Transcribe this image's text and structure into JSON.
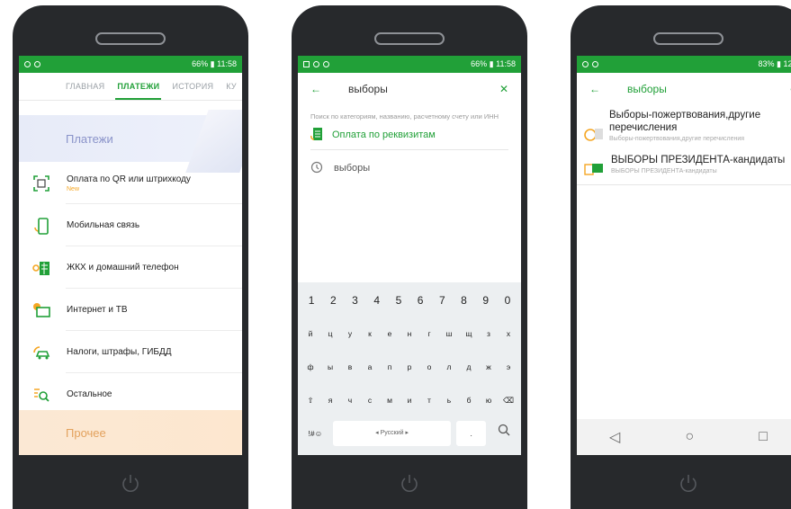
{
  "phone1": {
    "status": {
      "right": "66% ▮ 11:58"
    },
    "tabs": [
      "ГЛАВНАЯ",
      "ПЛАТЕЖИ",
      "ИСТОРИЯ",
      "КУ"
    ],
    "banner": "Платежи",
    "items": [
      {
        "label": "Оплата по QR или штрихкоду",
        "sub": "New",
        "icon": "qr-scan-icon"
      },
      {
        "label": "Мобильная связь",
        "sub": "",
        "icon": "mobile-phone-icon"
      },
      {
        "label": "ЖКХ и домашний телефон",
        "sub": "",
        "icon": "utilities-icon"
      },
      {
        "label": "Интернет и ТВ",
        "sub": "",
        "icon": "tv-icon"
      },
      {
        "label": "Налоги, штрафы, ГИБДД",
        "sub": "",
        "icon": "car-icon"
      },
      {
        "label": "Остальное",
        "sub": "",
        "icon": "search-list-icon"
      }
    ],
    "banner2": "Прочее"
  },
  "phone2": {
    "status": {
      "right": "66% ▮ 11:58"
    },
    "query": "выборы",
    "hint": "Поиск по категориям, названию, расчетному счету или ИНН",
    "requisites": "Оплата по реквизитам",
    "history_item": "выборы",
    "keyboard": {
      "numbers": [
        "1",
        "2",
        "3",
        "4",
        "5",
        "6",
        "7",
        "8",
        "9",
        "0"
      ],
      "row1": [
        "й",
        "ц",
        "у",
        "к",
        "е",
        "н",
        "г",
        "ш",
        "щ",
        "з",
        "х"
      ],
      "row2": [
        "ф",
        "ы",
        "в",
        "а",
        "п",
        "р",
        "о",
        "л",
        "д",
        "ж",
        "э"
      ],
      "row3": [
        "⇧",
        "я",
        "ч",
        "с",
        "м",
        "и",
        "т",
        "ь",
        "б",
        "ю",
        "⌫"
      ],
      "sym": "!#☺",
      "space": "◂ Русский ▸",
      "dot": "."
    }
  },
  "phone3": {
    "status": {
      "right": "83% ▮ 12:"
    },
    "query": "выборы",
    "results": [
      {
        "title": "Выборы-пожертвования,другие перечисления",
        "subtitle": "Выборы-пожертвования,другие перечисления"
      },
      {
        "title": "ВЫБОРЫ ПРЕЗИДЕНТА-кандидаты",
        "subtitle": "ВЫБОРЫ ПРЕЗИДЕНТА-кандидаты"
      }
    ],
    "nav": [
      "◁",
      "○",
      "□"
    ]
  },
  "colors": {
    "accent": "#21a038",
    "bezel": "#27292c"
  }
}
